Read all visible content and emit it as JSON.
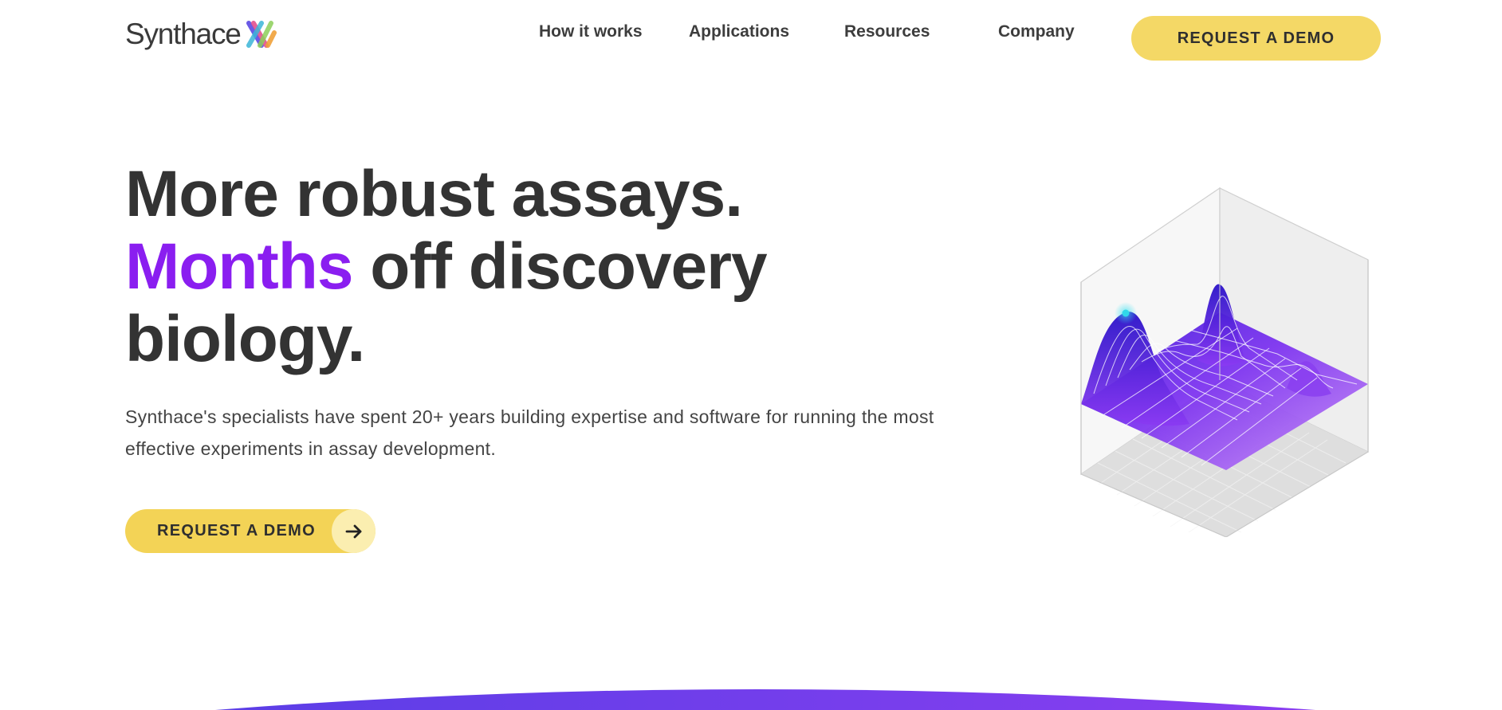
{
  "brand": {
    "name": "Synthace"
  },
  "nav": {
    "items": [
      {
        "label": "How it works"
      },
      {
        "label": "Applications"
      },
      {
        "label": "Resources"
      },
      {
        "label": "Company"
      }
    ],
    "cta_label": "REQUEST A DEMO"
  },
  "hero": {
    "headline_line1": "More robust assays.",
    "headline_accent": "Months",
    "headline_line2_rest": " off discovery",
    "headline_line3": "biology.",
    "subtext": "Synthace's specialists have spent 20+ years building expertise and software for running the most effective experiments in assay development.",
    "cta_label": "REQUEST A DEMO",
    "cta_icon": "arrow-right-icon"
  },
  "colors": {
    "accent_purple": "#8a1ef0",
    "button_yellow": "#f4d866",
    "button_arrow_bg": "#fbeeb0",
    "text_dark": "#333333",
    "band_start": "#5b3ee6",
    "band_end": "#8a3ef0"
  }
}
